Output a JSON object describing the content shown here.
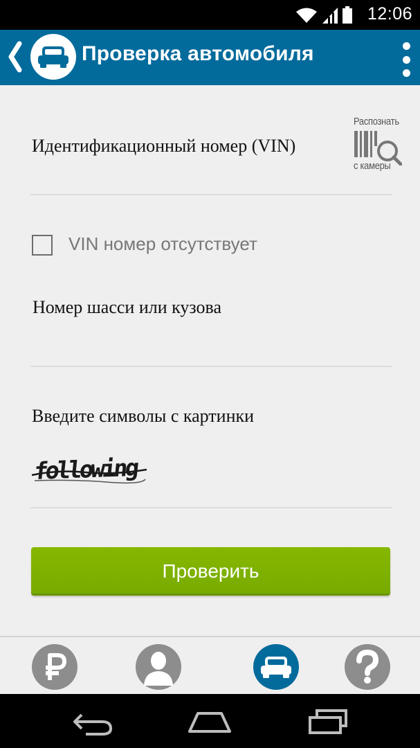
{
  "status_bar": {
    "time": "12:06",
    "icons": [
      "wifi-icon",
      "signal-icon",
      "battery-icon"
    ]
  },
  "action_bar": {
    "title": "Проверка автомобиля",
    "back_icon": "back-arrow-icon",
    "logo_icon": "car-icon",
    "menu_icon": "overflow-menu-icon",
    "color": "#036b9c"
  },
  "form": {
    "vin_label": "Идентификационный номер (VIN)",
    "scan_button": {
      "line1": "Распознать",
      "line2": "с камеры",
      "icon": "barcode-search-icon"
    },
    "vin_missing_checkbox": {
      "label": "VIN номер отсутствует",
      "checked": false
    },
    "chassis_label": "Номер шасси или кузова",
    "captcha_label": "Введите символы с картинки",
    "captcha_text": "following",
    "submit_label": "Проверить",
    "submit_color": "#7ab000"
  },
  "tab_bar": {
    "tabs": [
      {
        "name": "payment",
        "icon": "ruble-icon",
        "active": false
      },
      {
        "name": "profile",
        "icon": "user-icon",
        "active": false
      },
      {
        "name": "car-check",
        "icon": "car-icon",
        "active": true
      },
      {
        "name": "help",
        "icon": "question-icon",
        "active": false
      }
    ]
  },
  "nav_bar": {
    "icons": [
      "nav-back-icon",
      "nav-home-icon",
      "nav-recents-icon"
    ]
  }
}
